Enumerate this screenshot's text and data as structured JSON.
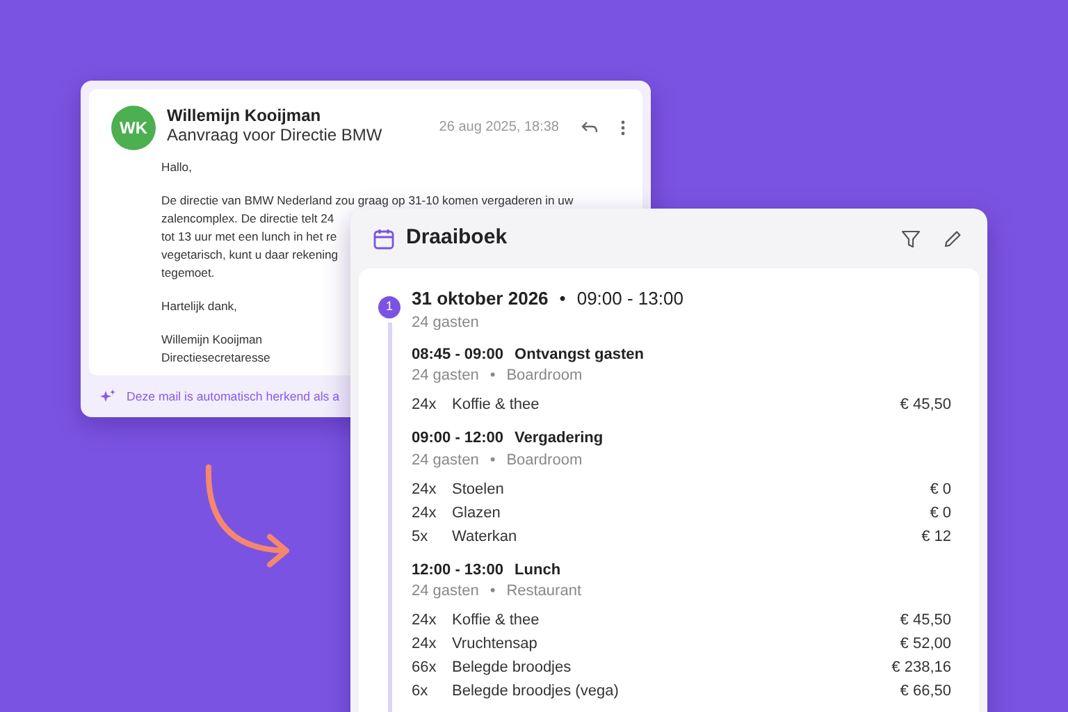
{
  "email": {
    "avatar_initials": "WK",
    "sender": "Willemijn Kooijman",
    "subject": "Aanvraag voor Directie BMW",
    "date": "26 aug 2025, 18:38",
    "body": [
      [
        "Hallo,"
      ],
      [
        "De directie van BMW Nederland zou graag op 31-10 komen vergaderen in uw",
        "zalencomplex. De directie telt 24",
        "tot 13 uur met een lunch in het re",
        "vegetarisch, kunt u daar rekening",
        "tegemoet."
      ],
      [
        "Hartelijk dank,"
      ],
      [
        "Willemijn Kooijman",
        "Directiesecretaresse"
      ]
    ],
    "footer_note": "Deze mail is automatisch herkend als a"
  },
  "draaiboek": {
    "title": "Draaiboek",
    "separator": "•",
    "day": {
      "number": "1",
      "date": "31 oktober 2026",
      "time": "09:00 - 13:00",
      "guests": "24 gasten",
      "sessions": [
        {
          "time": "08:45 - 09:00",
          "title": "Ontvangst gasten",
          "guests": "24 gasten",
          "room": "Boardroom",
          "items": [
            {
              "qty": "24x",
              "name": "Koffie & thee",
              "price": "€ 45,50"
            }
          ]
        },
        {
          "time": "09:00 - 12:00",
          "title": "Vergadering",
          "guests": "24 gasten",
          "room": "Boardroom",
          "items": [
            {
              "qty": "24x",
              "name": "Stoelen",
              "price": "€ 0"
            },
            {
              "qty": "24x",
              "name": "Glazen",
              "price": "€ 0"
            },
            {
              "qty": "5x",
              "name": "Waterkan",
              "price": "€ 12"
            }
          ]
        },
        {
          "time": "12:00 - 13:00",
          "title": "Lunch",
          "guests": "24 gasten",
          "room": "Restaurant",
          "items": [
            {
              "qty": "24x",
              "name": "Koffie & thee",
              "price": "€ 45,50"
            },
            {
              "qty": "24x",
              "name": "Vruchtensap",
              "price": "€ 52,00"
            },
            {
              "qty": "66x",
              "name": "Belegde broodjes",
              "price": "€ 238,16"
            },
            {
              "qty": "6x",
              "name": "Belegde broodjes (vega)",
              "price": "€ 66,50"
            }
          ]
        }
      ]
    }
  }
}
